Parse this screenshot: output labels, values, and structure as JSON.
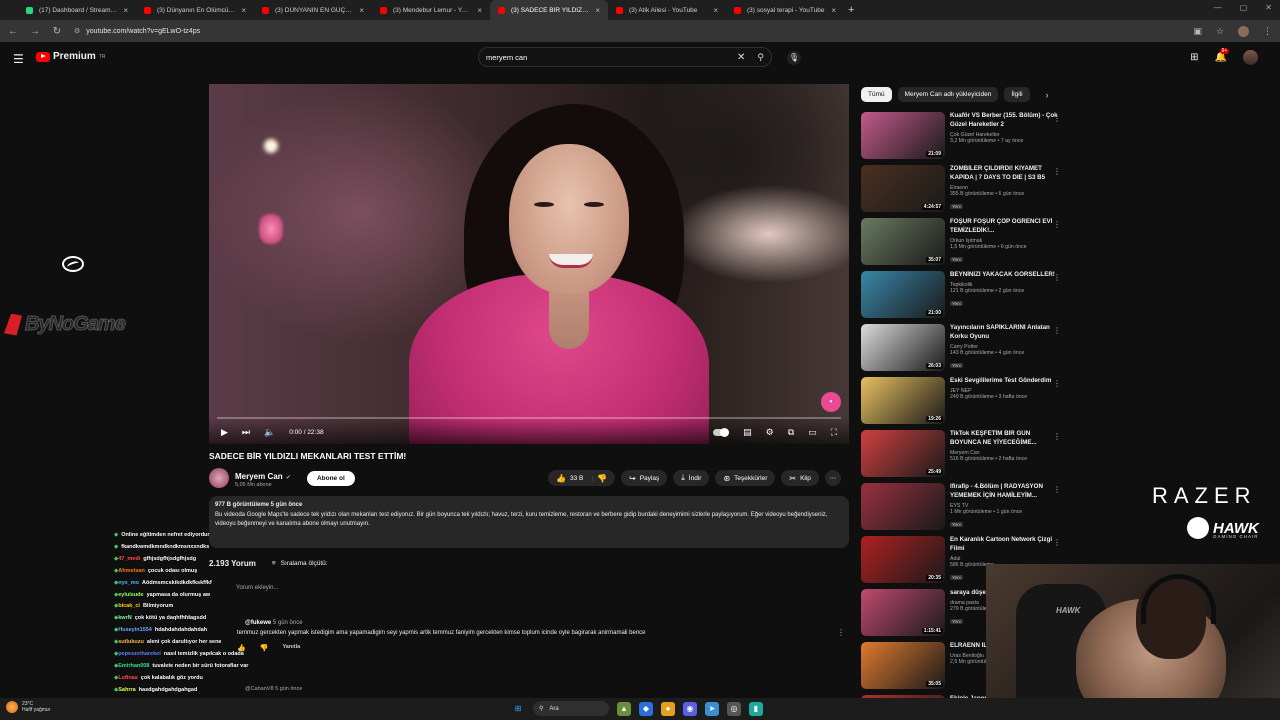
{
  "browser": {
    "tabs": [
      {
        "title": "(17) Dashboard / Streamlabs",
        "favicon": "streamlabs-icon",
        "active": false
      },
      {
        "title": "(3) Dünyanın En Ölümcül Engel",
        "favicon": "youtube-icon",
        "active": false
      },
      {
        "title": "(3) DÜNYANIN EN GÜÇLÜ ADAM",
        "favicon": "youtube-icon",
        "active": false
      },
      {
        "title": "(3) Mendebur Lemur - YouTube",
        "favicon": "youtube-icon",
        "active": false
      },
      {
        "title": "(3) SADECE BİR YILDIZLI MEKAN",
        "favicon": "youtube-icon",
        "active": true
      },
      {
        "title": "(3) Atik Ailesi - YouTube",
        "favicon": "youtube-icon",
        "active": false
      },
      {
        "title": "(3) sosyal terapi - YouTube",
        "favicon": "youtube-icon",
        "active": false
      }
    ],
    "url": "youtube.com/watch?v=gELwO-tz4ps"
  },
  "header": {
    "logo_text": "Premium",
    "logo_sup": "TR",
    "search_value": "meryem can",
    "notif_count": "9+"
  },
  "player": {
    "time": "0:00 / 22:38",
    "progress": 0
  },
  "video": {
    "title": "SADECE BİR YILDIZLI MEKANLARI TEST ETTİM!",
    "channel": "Meryem Can",
    "subs": "5,05 Mn abone",
    "subscribe_label": "Abone ol",
    "likes": "33 B",
    "share": "Paylaş",
    "download": "İndir",
    "thanks": "Teşekkürler",
    "clip": "Klip",
    "description_meta": "977 B görüntüleme  5 gün önce",
    "description": "Bu videoda Google Maps'te sadece tek yıldızı olan mekanları test ediyoruz. Bir gün boyunca tek yıldızlı; havuz, terzi, kuru temizleme, restoran ve berbere gidip burdaki deneyimimi sizlerle paylaşıyorum. Eğer videoyu beğendiyseniz, videoyu beğenmeyi ve kanalıma abone olmayı unutmayın."
  },
  "comments": {
    "count_label": "2.193 Yorum",
    "sort_label": "Sıralama ölçütü:",
    "add_placeholder": "Yorum ekleyin...",
    "first": {
      "user": "@fukewe",
      "time": "5 gün önce",
      "text": "temmuz gercekten yapmak istedigim ama yapamadigim seyi yapmis artik temmuz faniyim gercekten kimse toplum icinde oyle bagirarak anirmamali bence",
      "reply": "Yanıtla"
    },
    "second": {
      "user": "@CahanV8",
      "time": "5 gün önce"
    }
  },
  "chat": [
    {
      "name": "",
      "text": "Online eğitimden nefret ediyordur",
      "color": "#6fa8ff"
    },
    {
      "name": "",
      "text": "fkandkwmdkmndkndkmsnxxndks",
      "color": "#6fa8ff"
    },
    {
      "name": "47_medi",
      "text": "gfhjsdgfhjsdgfhjsdg",
      "color": "#ff4d4d"
    },
    {
      "name": "Ahmetsan",
      "text": "çocuk odası olmuş",
      "color": "#ff7a00"
    },
    {
      "name": "nyx_mo",
      "text": "Aödmsmcskikdkdkfkskffkf",
      "color": "#3fc1ff"
    },
    {
      "name": "eylulsude",
      "text": "yapmasa da olurmuş aw",
      "color": "#9aff66"
    },
    {
      "name": "bicak_ci",
      "text": "Bilmiyorum",
      "color": "#ffd700"
    },
    {
      "name": "kwrN",
      "text": "çok kötü ya daqhfhfdagsdd",
      "color": "#7cff9a"
    },
    {
      "name": "Huseyin1554",
      "text": "hdahdahdahdahdah",
      "color": "#6fa8ff"
    },
    {
      "name": "sutlukuzu",
      "text": "aleni çok darultıyor her sene",
      "color": "#ffb84d"
    },
    {
      "name": "pepeszeiharekel",
      "text": "nasıl temizlik yapılcak o odada",
      "color": "#5f7bff"
    },
    {
      "name": "Emirhan008",
      "text": "tuvalete neden bir sürü fotoraflar var",
      "color": "#2ee08a"
    },
    {
      "name": "Lufinas",
      "text": "çok kalabalık göz yordu",
      "color": "#ff4d4d"
    },
    {
      "name": "Sahrra",
      "text": "hasdgahdgahdgahgad",
      "color": "#d6ff4d"
    }
  ],
  "sidebar": {
    "chips": [
      "Tümü",
      "Meryem Can adlı yükleyiciden",
      "İlgili"
    ],
    "videos": [
      {
        "title": "Kuaför VS Berber (155. Bölüm) - Çok Güzel Hareketler 2",
        "channel": "Çok Güzel Hareketler",
        "meta": "3,2 Mn görüntüleme • 7 ay önce",
        "duration": "21:09",
        "new": "",
        "thumb": "#c45a8a"
      },
      {
        "title": "ZOMBİLER ÇILDIRDI! KIYAMET KAPIDA | 7 DAYS TO DIE | S3 B5",
        "channel": "Elraenn",
        "meta": "355 B görüntüleme • 6 gün önce",
        "duration": "4:24:57",
        "new": "Yeni",
        "thumb": "#4a3020"
      },
      {
        "title": "FOŞUR FOŞUR ÇÖP ÖĞRENCİ EVİ TEMİZLEDİK!...",
        "channel": "Orkun Işıtmak",
        "meta": "1,5 Mn görüntüleme • 6 gün önce",
        "duration": "35:07",
        "new": "Yeni",
        "thumb": "#6a7a60"
      },
      {
        "title": "BEYNİNİZİ YAKACAK GÖRSELLER!",
        "channel": "Tepkikolik",
        "meta": "121 B görüntüleme • 2 gün önce",
        "duration": "21:00",
        "new": "Yeni",
        "thumb": "#3a86a8"
      },
      {
        "title": "Yayıncıların SAPIKLARINI Anlatan Korku Oyunu",
        "channel": "Carry Potter",
        "meta": "143 B görüntüleme • 4 gün önce",
        "duration": "26:03",
        "new": "Yeni",
        "thumb": "#dcdcdc"
      },
      {
        "title": "Eski Sevgililerime Test Gönderdim",
        "channel": "JEY NEP",
        "meta": "249 B görüntüleme • 3 hafta önce",
        "duration": "19:26",
        "new": "",
        "thumb": "#e8c060"
      },
      {
        "title": "TikTok KEŞFETİM BİR GÜN BOYUNCA NE YİYECEĞİME...",
        "channel": "Meryem Can",
        "meta": "516 B görüntüleme • 2 hafta önce",
        "duration": "25:49",
        "new": "",
        "thumb": "#d04040"
      },
      {
        "title": "Ifirafip - 4.Bölüm | RADYASYON YEMEMEK İÇİN HAMİLEYİM...",
        "channel": "EYS TV",
        "meta": "1 Mn görüntüleme • 1 gün önce",
        "duration": "",
        "new": "Yeni",
        "thumb": "#9a3040"
      },
      {
        "title": "En Karanlık Cartoon Network Çizgi Filmi",
        "channel": "Adal",
        "meta": "586 B görüntüleme",
        "duration": "20:35",
        "new": "Yeni",
        "thumb": "#b02020"
      },
      {
        "title": "saraya düşen MEGHAN M...",
        "channel": "drama pasta",
        "meta": "279 B görüntüleme",
        "duration": "1:15:41",
        "new": "Yeni",
        "thumb": "#c04a70"
      },
      {
        "title": "ELRAENN İLE AT YA DA...",
        "channel": "Uras Benlioğlu",
        "meta": "2,5 Mn görüntüleme",
        "duration": "35:05",
        "new": "",
        "thumb": "#e07a30"
      },
      {
        "title": "Ekiple Japon...",
        "channel": "",
        "meta": "",
        "duration": "",
        "new": "",
        "thumb": "#b03030"
      }
    ]
  },
  "overlay": {
    "sponsor": "ByNoGame",
    "razer": "RAZER",
    "hawk": "HAWK",
    "hawk_sub": "GAMING CHAIR"
  },
  "taskbar": {
    "temp": "23°C",
    "weather": "Hafif yağmur",
    "search": "Ara"
  }
}
